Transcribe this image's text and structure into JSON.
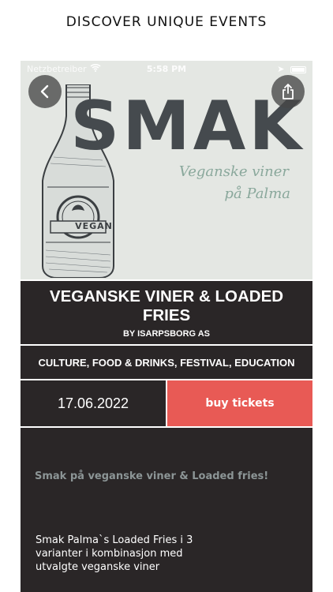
{
  "caption": "DISCOVER UNIQUE EVENTS",
  "status_bar": {
    "carrier": "Netzbetreiber",
    "time": "5:58 PM"
  },
  "hero": {
    "brand": "SMAK",
    "tagline_1": "Veganske viner",
    "tagline_2": "på Palma",
    "bottle_label": "VEGAN",
    "back_icon": "chevron-left-icon",
    "share_icon": "share-icon"
  },
  "event": {
    "title": "VEGANSKE VINER & LOADED FRIES",
    "organizer": "BY ISARPSBORG AS",
    "categories": "CULTURE, FOOD & DRINKS, FESTIVAL, EDUCATION",
    "date": "17.06.2022",
    "buy_label": "buy tickets",
    "description_heading": "Smak på veganske viner & Loaded fries!",
    "description_body": "Smak Palma`s Loaded Fries i 3 varianter i kombinasjon med utvalgte veganske viner"
  },
  "colors": {
    "panel_bg": "#2a2627",
    "accent": "#e85a55",
    "hero_bg": "#e4e7e3"
  }
}
